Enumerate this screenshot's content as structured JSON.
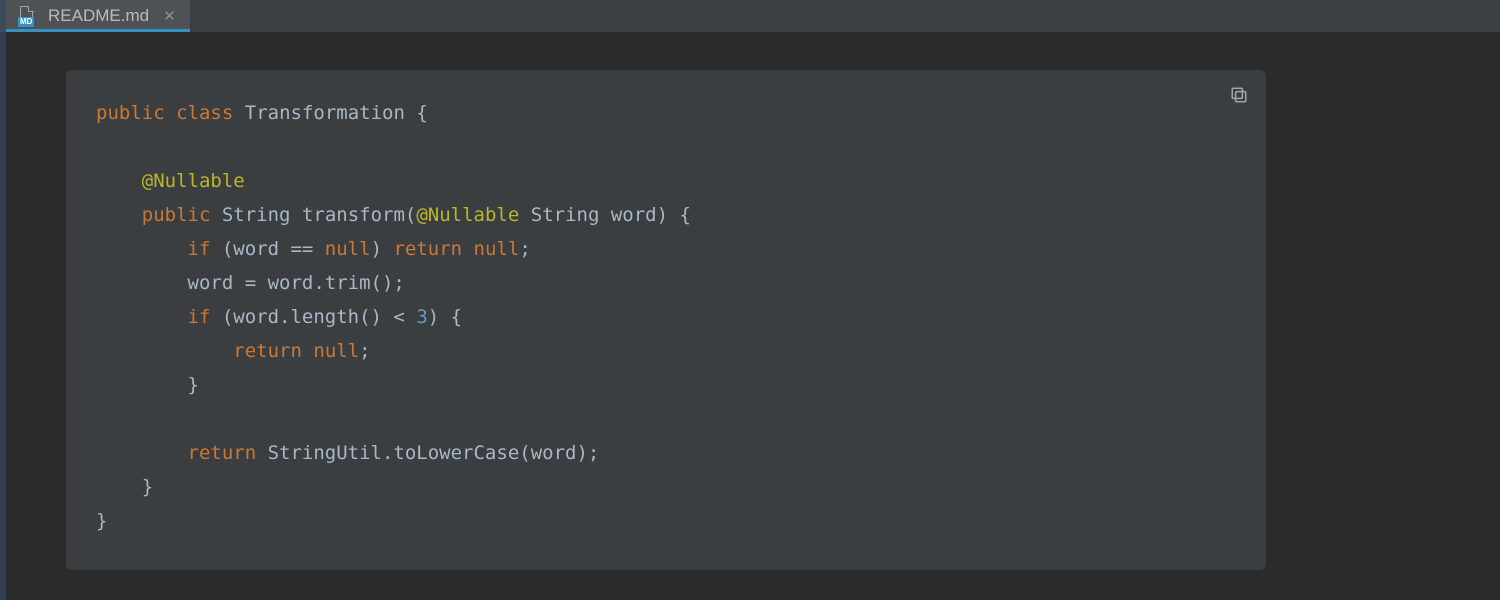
{
  "tab": {
    "filename": "README.md",
    "icon_badge": "MD"
  },
  "code_tokens": [
    [
      {
        "t": "public",
        "c": "kw"
      },
      {
        "t": " "
      },
      {
        "t": "class",
        "c": "kw"
      },
      {
        "t": " "
      },
      {
        "t": "Transformation",
        "c": "cls"
      },
      {
        "t": " "
      },
      {
        "t": "{",
        "c": "punc"
      }
    ],
    [],
    [
      {
        "t": "    "
      },
      {
        "t": "@Nullable",
        "c": "ann"
      }
    ],
    [
      {
        "t": "    "
      },
      {
        "t": "public",
        "c": "kw"
      },
      {
        "t": " "
      },
      {
        "t": "String",
        "c": "cls"
      },
      {
        "t": " "
      },
      {
        "t": "transform(",
        "c": "id"
      },
      {
        "t": "@Nullable",
        "c": "ann"
      },
      {
        "t": " "
      },
      {
        "t": "String",
        "c": "cls"
      },
      {
        "t": " "
      },
      {
        "t": "word) {",
        "c": "id"
      }
    ],
    [
      {
        "t": "        "
      },
      {
        "t": "if",
        "c": "kw"
      },
      {
        "t": " (word == ",
        "c": "id"
      },
      {
        "t": "null",
        "c": "kw"
      },
      {
        "t": ") ",
        "c": "id"
      },
      {
        "t": "return",
        "c": "kw"
      },
      {
        "t": " ",
        "c": "id"
      },
      {
        "t": "null",
        "c": "kw"
      },
      {
        "t": ";",
        "c": "punc"
      }
    ],
    [
      {
        "t": "        "
      },
      {
        "t": "word = word.trim();",
        "c": "id"
      }
    ],
    [
      {
        "t": "        "
      },
      {
        "t": "if",
        "c": "kw"
      },
      {
        "t": " (word.length() < ",
        "c": "id"
      },
      {
        "t": "3",
        "c": "num"
      },
      {
        "t": ") {",
        "c": "id"
      }
    ],
    [
      {
        "t": "            "
      },
      {
        "t": "return",
        "c": "kw"
      },
      {
        "t": " ",
        "c": "id"
      },
      {
        "t": "null",
        "c": "kw"
      },
      {
        "t": ";",
        "c": "punc"
      }
    ],
    [
      {
        "t": "        "
      },
      {
        "t": "}",
        "c": "punc"
      }
    ],
    [],
    [
      {
        "t": "        "
      },
      {
        "t": "return",
        "c": "kw"
      },
      {
        "t": " StringUtil.toLowerCase(word);",
        "c": "id"
      }
    ],
    [
      {
        "t": "    "
      },
      {
        "t": "}",
        "c": "punc"
      }
    ],
    [
      {
        "t": "}",
        "c": "punc"
      }
    ]
  ]
}
